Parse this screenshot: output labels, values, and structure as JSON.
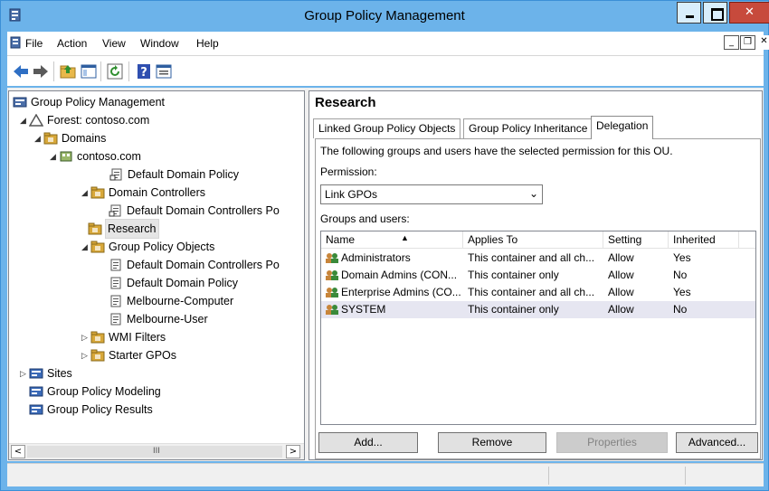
{
  "window": {
    "title": "Group Policy Management"
  },
  "menu": {
    "items": [
      "File",
      "Action",
      "View",
      "Window",
      "Help"
    ]
  },
  "toolbar": {
    "tools": [
      "back-icon",
      "forward-icon",
      "up-folder-icon",
      "show-hide-tree-icon",
      "refresh-icon",
      "help-icon",
      "properties-icon"
    ]
  },
  "tree": {
    "nodes": [
      {
        "label": "Group Policy Management",
        "icon": "gpm-console-icon",
        "expander": ""
      },
      {
        "label": "Forest: contoso.com",
        "icon": "forest-icon",
        "expander": "◢"
      },
      {
        "label": "Domains",
        "icon": "domains-folder-icon",
        "expander": "◢"
      },
      {
        "label": "contoso.com",
        "icon": "domain-icon",
        "expander": "◢"
      },
      {
        "label": "Default Domain Policy",
        "icon": "gpo-link-icon",
        "expander": ""
      },
      {
        "label": "Domain Controllers",
        "icon": "ou-icon",
        "expander": "◢"
      },
      {
        "label": "Default Domain Controllers Po",
        "icon": "gpo-link-icon",
        "expander": ""
      },
      {
        "label": "Research",
        "icon": "ou-icon",
        "expander": ""
      },
      {
        "label": "Group Policy Objects",
        "icon": "gpo-folder-icon",
        "expander": "◢"
      },
      {
        "label": "Default Domain Controllers Po",
        "icon": "gpo-icon",
        "expander": ""
      },
      {
        "label": "Default Domain Policy",
        "icon": "gpo-icon",
        "expander": ""
      },
      {
        "label": "Melbourne-Computer",
        "icon": "gpo-icon",
        "expander": ""
      },
      {
        "label": "Melbourne-User",
        "icon": "gpo-icon",
        "expander": ""
      },
      {
        "label": "WMI Filters",
        "icon": "wmi-filter-folder-icon",
        "expander": "▷"
      },
      {
        "label": "Starter GPOs",
        "icon": "starter-gpo-folder-icon",
        "expander": "▷"
      },
      {
        "label": "Sites",
        "icon": "sites-icon",
        "expander": "▷"
      },
      {
        "label": "Group Policy Modeling",
        "icon": "modeling-icon",
        "expander": ""
      },
      {
        "label": "Group Policy Results",
        "icon": "results-icon",
        "expander": ""
      }
    ],
    "scroll_grip": "III"
  },
  "details": {
    "title": "Research",
    "tabs": [
      "Linked Group Policy Objects",
      "Group Policy Inheritance",
      "Delegation"
    ],
    "active_tab": "Delegation",
    "description": "The following groups and users have the selected permission for this OU.",
    "permission_label": "Permission:",
    "permission_value": "Link GPOs",
    "groups_label": "Groups and users:",
    "columns": [
      "Name",
      "Applies To",
      "Setting",
      "Inherited"
    ],
    "rows": [
      {
        "name": "Administrators",
        "applies_to": "This container and all ch...",
        "setting": "Allow",
        "inherited": "Yes"
      },
      {
        "name": "Domain Admins (CON...",
        "applies_to": "This container only",
        "setting": "Allow",
        "inherited": "No"
      },
      {
        "name": "Enterprise Admins (CO...",
        "applies_to": "This container and all ch...",
        "setting": "Allow",
        "inherited": "Yes"
      },
      {
        "name": "SYSTEM",
        "applies_to": "This container only",
        "setting": "Allow",
        "inherited": "No"
      }
    ],
    "buttons": {
      "add": "Add...",
      "remove": "Remove",
      "properties": "Properties",
      "advanced": "Advanced..."
    }
  }
}
